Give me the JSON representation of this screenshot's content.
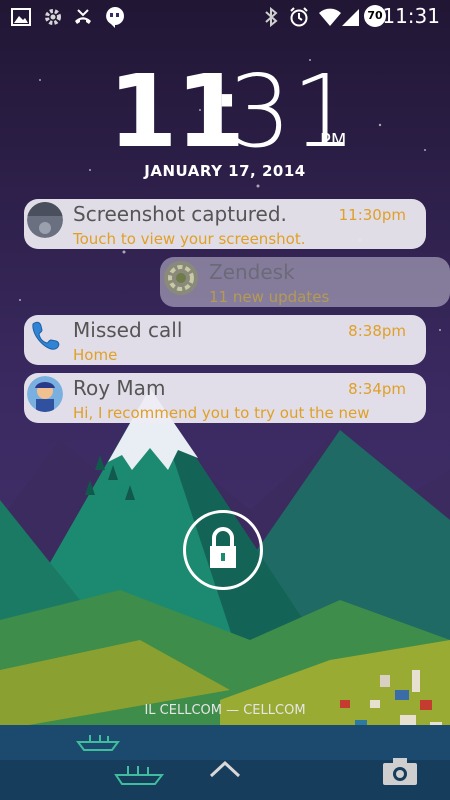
{
  "status_bar": {
    "left_icons": [
      "image-icon",
      "settings-icon",
      "missed-call-icon",
      "hangouts-icon"
    ],
    "right_icons": [
      "bluetooth-icon",
      "alarm-icon",
      "wifi-icon",
      "signal-icon"
    ],
    "battery": "70",
    "time": "11:31"
  },
  "lockscreen": {
    "clock_hour": "11",
    "clock_colon": ":",
    "clock_minute": "31",
    "clock_ampm": "PM",
    "date": "JANUARY 17, 2014",
    "notifications": [
      {
        "title": "Screenshot captured.",
        "time": "11:30pm",
        "text": "Touch to view your screenshot.",
        "icon": "screenshot-thumbnail"
      },
      {
        "title": "Zendesk",
        "time": "",
        "text": "11 new updates",
        "icon": "zendesk-icon"
      },
      {
        "title": "Missed call",
        "time": "8:38pm",
        "text": "Home",
        "icon": "phone-icon"
      },
      {
        "title": "Roy Mam",
        "time": "8:34pm",
        "text": "Hi, I recommend you to try out the new",
        "icon": "contact-avatar"
      }
    ],
    "carrier": "IL CELLCOM — CELLCOM",
    "unlock_icon": "lock-icon",
    "bottom_icons": [
      "chevron-up-icon",
      "camera-icon"
    ]
  }
}
